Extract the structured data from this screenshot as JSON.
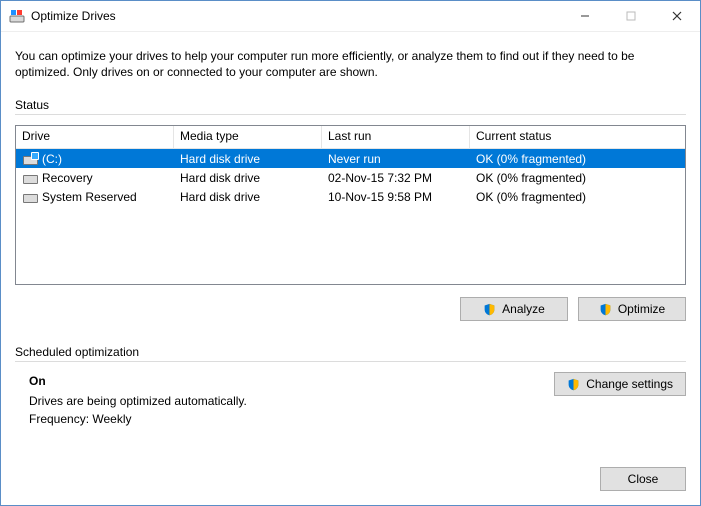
{
  "window": {
    "title": "Optimize Drives"
  },
  "description": "You can optimize your drives to help your computer run more efficiently, or analyze them to find out if they need to be optimized. Only drives on or connected to your computer are shown.",
  "status_section": {
    "label": "Status",
    "columns": {
      "drive": "Drive",
      "media": "Media type",
      "last": "Last run",
      "status": "Current status"
    },
    "rows": [
      {
        "drive": "(C:)",
        "media": "Hard disk drive",
        "last": "Never run",
        "status": "OK (0% fragmented)",
        "selected": true,
        "icon": "os"
      },
      {
        "drive": "Recovery",
        "media": "Hard disk drive",
        "last": "02-Nov-15 7:32 PM",
        "status": "OK (0% fragmented)",
        "selected": false,
        "icon": "hdd"
      },
      {
        "drive": "System Reserved",
        "media": "Hard disk drive",
        "last": "10-Nov-15 9:58 PM",
        "status": "OK (0% fragmented)",
        "selected": false,
        "icon": "hdd"
      }
    ]
  },
  "buttons": {
    "analyze": "Analyze",
    "optimize": "Optimize",
    "change_settings": "Change settings",
    "close": "Close"
  },
  "scheduled": {
    "label": "Scheduled optimization",
    "state": "On",
    "desc": "Drives are being optimized automatically.",
    "freq": "Frequency: Weekly"
  }
}
